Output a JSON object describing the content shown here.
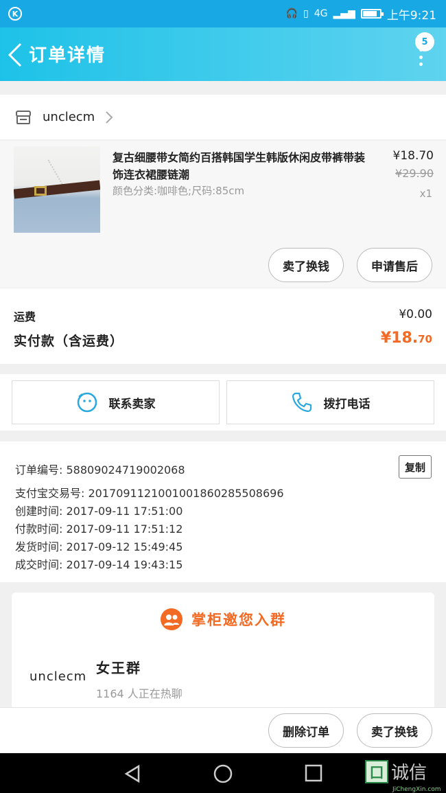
{
  "status_bar": {
    "time": "上午9:21",
    "network": "4G"
  },
  "nav": {
    "title": "订单详情",
    "badge": "5"
  },
  "shop": {
    "name": "unclecm"
  },
  "item": {
    "title": "复古细腰带女简约百搭韩国学生韩版休闲皮带裤带装饰连衣裙腰链潮",
    "sku": "颜色分类:咖啡色;尺码:85cm",
    "price": "¥18.70",
    "original_price": "¥29.90",
    "quantity": "x1",
    "btn_resell": "卖了换钱",
    "btn_aftersale": "申请售后"
  },
  "fees": {
    "shipping_label": "运费",
    "shipping_value": "¥0.00",
    "paid_label": "实付款（含运费）",
    "paid_main": "¥18.",
    "paid_cents": "70"
  },
  "contact": {
    "seller": "联系卖家",
    "phone": "拨打电话"
  },
  "order_info": {
    "order_no": "订单编号: 58809024719002068",
    "copy": "复制",
    "alipay_no": "支付宝交易号: 2017091121001001860285508696",
    "created": "创建时间: 2017-09-11 17:51:00",
    "paid": "付款时间: 2017-09-11 17:51:12",
    "shipped": "发货时间: 2017-09-12 15:49:45",
    "completed": "成交时间: 2017-09-14 19:43:15"
  },
  "group": {
    "title": "掌柜邀您入群",
    "logo_text": "unclecm",
    "name": "女王群",
    "count": "1164 人正在热聊"
  },
  "bottom": {
    "delete": "删除订单",
    "resell": "卖了换钱"
  },
  "watermark": {
    "text": "诚信",
    "sub": "JiChengXin.com"
  },
  "colors": {
    "accent": "#18a8e3",
    "price": "#f26a23"
  }
}
